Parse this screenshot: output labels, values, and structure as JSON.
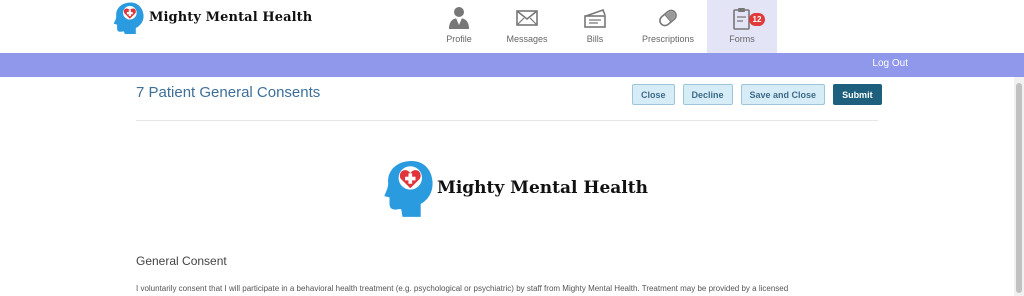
{
  "brand": {
    "name": "Mighty Mental Health"
  },
  "nav": {
    "items": [
      {
        "label": "Profile",
        "icon": "profile-icon"
      },
      {
        "label": "Messages",
        "icon": "envelope-icon"
      },
      {
        "label": "Bills",
        "icon": "bills-icon"
      },
      {
        "label": "Prescriptions",
        "icon": "pill-icon"
      },
      {
        "label": "Forms",
        "icon": "clipboard-icon",
        "badge": "12",
        "active": true
      }
    ]
  },
  "subbar": {
    "logout": "Log Out"
  },
  "form": {
    "title": "7 Patient General Consents",
    "buttons": {
      "close": "Close",
      "decline": "Decline",
      "save_close": "Save and Close",
      "submit": "Submit"
    },
    "logo_text": "Mighty Mental Health",
    "section_title": "General Consent",
    "consent_text": "I voluntarily consent that I will participate in a behavioral health treatment (e.g. psychological or psychiatric) by staff from Mighty Mental Health. Treatment may be provided by a licensed"
  },
  "colors": {
    "accent_bar": "#8f98ea",
    "title": "#3d6f98",
    "submit": "#1e5f7e",
    "badge": "#e03a3a",
    "logo_blue": "#2b9be0",
    "logo_heart": "#e0353a"
  }
}
